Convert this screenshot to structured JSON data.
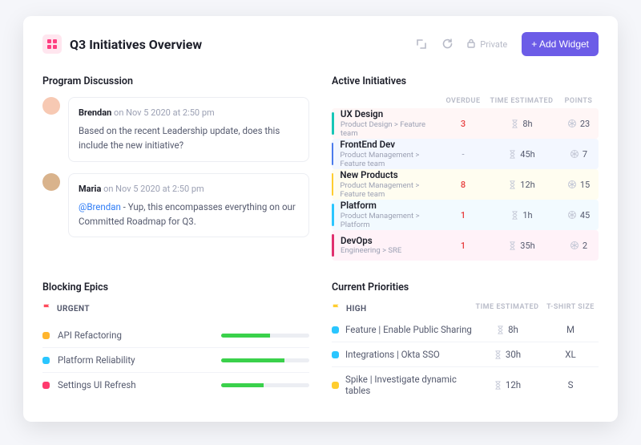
{
  "header": {
    "title": "Q3 Initiatives Overview",
    "private_label": "Private",
    "add_widget_label": "+ Add Widget"
  },
  "discussion": {
    "heading": "Program Discussion",
    "comments": [
      {
        "author": "Brendan",
        "timestamp": "Nov 5 2020 at 2:50 pm",
        "body_plain": "Based on the recent Leadership update, does this include the new initiative?",
        "avatar_bg": "#f7c9b3"
      },
      {
        "author": "Maria",
        "timestamp": "Nov 5 2020 at 2:50 pm",
        "mention": "@Brendan",
        "body_plain": " - Yup, this encompasses everything on our Committed Roadmap for Q3.",
        "avatar_bg": "#d9b38c"
      }
    ]
  },
  "initiatives": {
    "heading": "Active Initiatives",
    "columns": {
      "overdue": "OVERDUE",
      "time": "TIME ESTIMATED",
      "points": "POINTS"
    },
    "rows": [
      {
        "title": "UX Design",
        "subtitle": "Product Design > Feature team",
        "overdue": "3",
        "hours": "8h",
        "points": "23",
        "bar": "#17c6b6",
        "bg": "#fff6f6"
      },
      {
        "title": "FrontEnd Dev",
        "subtitle": "Product Management > Feature team",
        "overdue": "-",
        "hours": "45h",
        "points": "7",
        "bar": "#4b7bec",
        "bg": "#f3f7ff"
      },
      {
        "title": "New Products",
        "subtitle": "Product Management > Feature team",
        "overdue": "8",
        "hours": "12h",
        "points": "15",
        "bar": "#ffcd2e",
        "bg": "#fffdf0"
      },
      {
        "title": "Platform",
        "subtitle": "Product Management > Platform",
        "overdue": "1",
        "hours": "1h",
        "points": "45",
        "bar": "#2ac6ff",
        "bg": "#f2faff"
      },
      {
        "title": "DevOps",
        "subtitle": "Engineering > SRE",
        "overdue": "1",
        "hours": "35h",
        "points": "2",
        "bar": "#e0306f",
        "bg": "#fff2f8"
      }
    ]
  },
  "blocking": {
    "heading": "Blocking Epics",
    "flag_label": "URGENT",
    "flag_color": "#ff4a5c",
    "rows": [
      {
        "label": "API Refactoring",
        "dot": "#ffb52e",
        "progress_pct": 55
      },
      {
        "label": "Platform Reliability",
        "dot": "#2ac6ff",
        "progress_pct": 72
      },
      {
        "label": "Settings UI Refresh",
        "dot": "#ff3a6e",
        "progress_pct": 48
      }
    ]
  },
  "priorities": {
    "heading": "Current Priorities",
    "flag_label": "HIGH",
    "flag_color": "#ffcd2e",
    "columns": {
      "time": "TIME ESTIMATED",
      "size": "T-SHIRT SIZE"
    },
    "rows": [
      {
        "label": "Feature | Enable Public Sharing",
        "dot": "#2ac6ff",
        "hours": "8h",
        "size": "M"
      },
      {
        "label": "Integrations | Okta SSO",
        "dot": "#2ac6ff",
        "hours": "30h",
        "size": "XL"
      },
      {
        "label": "Spike | Investigate dynamic tables",
        "dot": "#ffcd2e",
        "hours": "12h",
        "size": "S"
      }
    ]
  }
}
